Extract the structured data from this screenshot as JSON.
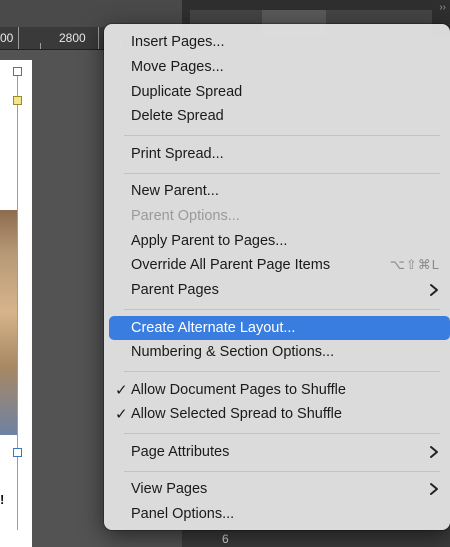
{
  "ruler": {
    "labels": [
      "00",
      "2800"
    ]
  },
  "panel": {
    "page_label": "6"
  },
  "document": {
    "snippet": "!"
  },
  "menu": {
    "groups": [
      {
        "items": [
          {
            "label": "Insert Pages..."
          },
          {
            "label": "Move Pages..."
          },
          {
            "label": "Duplicate Spread"
          },
          {
            "label": "Delete Spread"
          }
        ]
      },
      {
        "items": [
          {
            "label": "Print Spread..."
          }
        ]
      },
      {
        "items": [
          {
            "label": "New Parent..."
          },
          {
            "label": "Parent Options...",
            "disabled": true
          },
          {
            "label": "Apply Parent to Pages..."
          },
          {
            "label": "Override All Parent Page Items",
            "shortcut": "⌥⇧⌘L"
          },
          {
            "label": "Parent Pages",
            "submenu": true
          }
        ]
      },
      {
        "items": [
          {
            "label": "Create Alternate Layout...",
            "highlighted": true
          },
          {
            "label": "Numbering & Section Options..."
          }
        ]
      },
      {
        "items": [
          {
            "label": "Allow Document Pages to Shuffle",
            "checked": true
          },
          {
            "label": "Allow Selected Spread to Shuffle",
            "checked": true
          }
        ]
      },
      {
        "items": [
          {
            "label": "Page Attributes",
            "submenu": true
          }
        ]
      },
      {
        "items": [
          {
            "label": "View Pages",
            "submenu": true
          },
          {
            "label": "Panel Options..."
          }
        ]
      }
    ],
    "check_glyph": "✓",
    "accent_color": "#3a7de0"
  }
}
